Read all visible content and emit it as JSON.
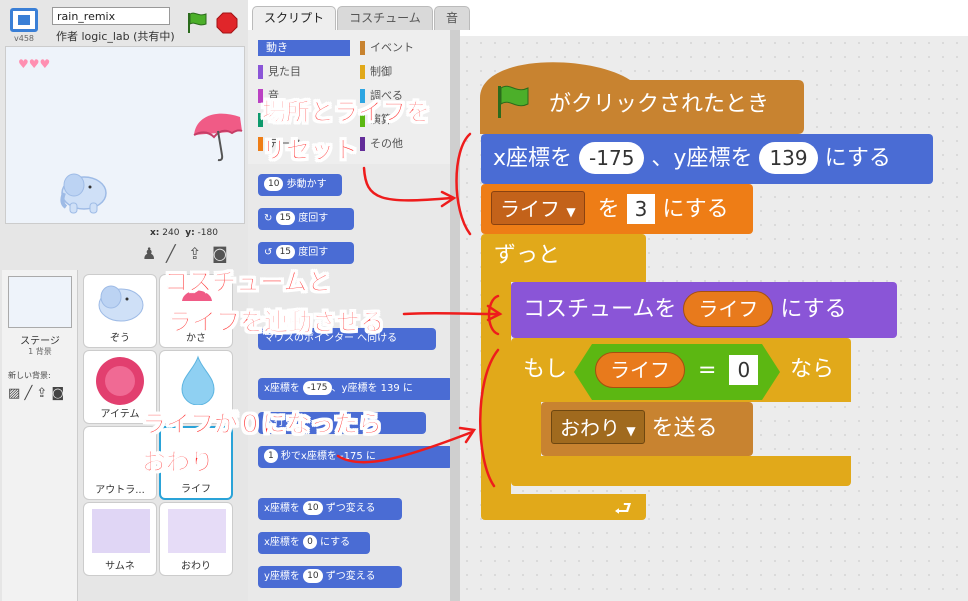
{
  "topbar": {
    "version": "v458",
    "project_name": "rain_remix",
    "author": "作者 logic_lab (共有中)"
  },
  "stage": {
    "coord_x_label": "x:",
    "coord_x": "240",
    "coord_y_label": "y:",
    "coord_y": "-180",
    "hearts": "♥♥♥"
  },
  "stage_panel": {
    "label": "ステージ",
    "sub": "1 背景",
    "new_backdrop": "新しい背景:"
  },
  "sprites": [
    {
      "name": "ぞう"
    },
    {
      "name": "かさ"
    },
    {
      "name": "アイテム"
    },
    {
      "name": "？？"
    },
    {
      "name": "アウトラ..."
    },
    {
      "name": "ライフ"
    },
    {
      "name": "サムネ"
    },
    {
      "name": "おわり"
    }
  ],
  "tabs": {
    "script": "スクリプト",
    "costume": "コスチューム",
    "sound": "音"
  },
  "categories": [
    {
      "label": "動き",
      "color": "#4a6cd4"
    },
    {
      "label": "イベント",
      "color": "#c88330"
    },
    {
      "label": "見た目",
      "color": "#8a55d7"
    },
    {
      "label": "制御",
      "color": "#e1a91a"
    },
    {
      "label": "音",
      "color": "#bb42c3"
    },
    {
      "label": "調べる",
      "color": "#2ca5e2"
    },
    {
      "label": "ペン",
      "color": "#0e9a6c"
    },
    {
      "label": "演算",
      "color": "#5cb712"
    },
    {
      "label": "データ",
      "color": "#ee7d16"
    },
    {
      "label": "その他",
      "color": "#632d99"
    }
  ],
  "palette_blocks": [
    {
      "pre": "",
      "num": "10",
      "post": "歩動かす"
    },
    {
      "pre": "↻",
      "num": "15",
      "post": "度回す"
    },
    {
      "pre": "↺",
      "num": "15",
      "post": "度回す"
    },
    {
      "pre": "",
      "num": "",
      "post": "マウスのポインター へ向ける"
    },
    {
      "pre": "x座標を",
      "num": "-175",
      "post": "、y座標を 139 に"
    },
    {
      "pre": "",
      "num": "",
      "post": "へ行く"
    },
    {
      "pre": "",
      "num": "1",
      "post": "秒でx座標を -175 に"
    },
    {
      "pre": "x座標を",
      "num": "10",
      "post": "ずつ変える"
    },
    {
      "pre": "x座標を",
      "num": "0",
      "post": "にする"
    },
    {
      "pre": "y座標を",
      "num": "10",
      "post": "ずつ変える"
    }
  ],
  "script": {
    "hat_label": "がクリックされたとき",
    "goto_x_label": "x座標を",
    "goto_x": "-175",
    "goto_y_label": "、y座標を",
    "goto_y": "139",
    "goto_suffix": "にする",
    "setvar_dropdown": "ライフ",
    "setvar_to": "を",
    "setvar_value": "3",
    "setvar_suffix": "にする",
    "forever_label": "ずっと",
    "costume_label": "コスチュームを",
    "costume_value": "ライフ",
    "costume_suffix": "にする",
    "if_label": "もし",
    "if_var": "ライフ",
    "if_eq": "=",
    "if_value": "0",
    "if_then": "なら",
    "broadcast_dropdown": "おわり",
    "broadcast_suffix": "を送る"
  },
  "annotations": {
    "a1_line1": "場所とライフを",
    "a1_line2": "リセット",
    "a2_line1": "コスチュームと",
    "a2_line2": "ライフを連動させる",
    "a3_line1": "ライフが０になったら",
    "a3_line2": "おわり"
  },
  "colors": {
    "motion": "#4a6cd4",
    "events": "#c88330",
    "control": "#e1a91a",
    "data": "#ee7d16",
    "looks": "#8a55d7",
    "operators": "#5cb712",
    "annotation": "#ff2a2a"
  }
}
